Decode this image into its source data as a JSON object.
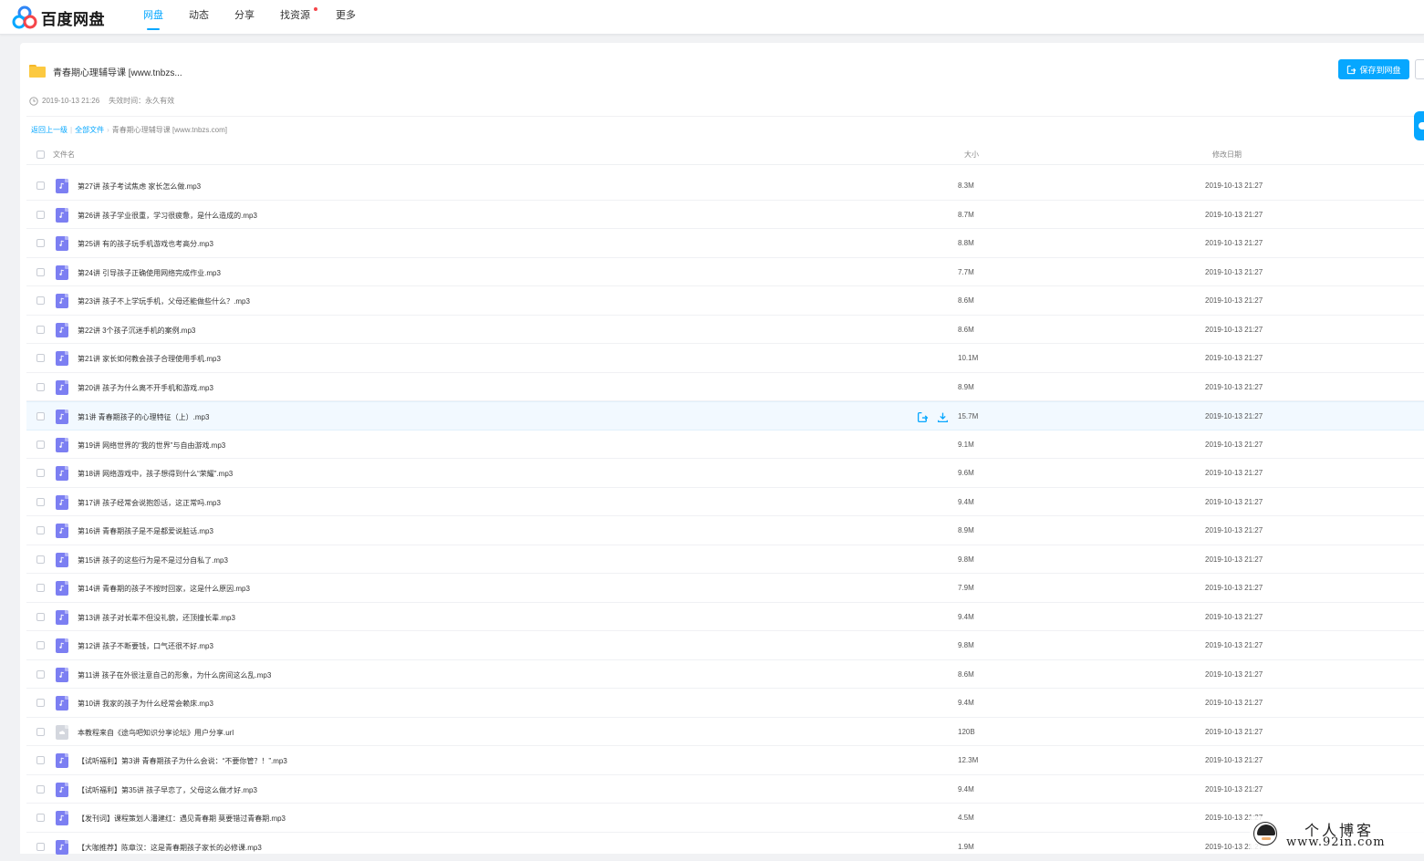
{
  "app": {
    "name": "百度网盘"
  },
  "nav": [
    {
      "label": "网盘",
      "active": true
    },
    {
      "label": "动态",
      "active": false
    },
    {
      "label": "分享",
      "active": false
    },
    {
      "label": "找资源",
      "active": false,
      "dot": true
    },
    {
      "label": "更多",
      "active": false
    }
  ],
  "share": {
    "title": "青春期心理辅导课 [www.tnbzs...",
    "created": "2019-10-13 21:26",
    "expire": "失效时间：永久有效",
    "save_label": "保存到网盘"
  },
  "breadcrumb": {
    "back": "返回上一级",
    "all": "全部文件",
    "sep": "|",
    "arrow": "›",
    "current": "青春期心理辅导课 [www.tnbzs.com]"
  },
  "table": {
    "col_name": "文件名",
    "col_size": "大小",
    "col_date": "修改日期",
    "rows": [
      {
        "name": "第27讲 孩子考试焦虑 家长怎么做.mp3",
        "size": "8.3M",
        "date": "2019-10-13 21:27",
        "type": "audio"
      },
      {
        "name": "第26讲 孩子学业很重，学习很疲惫，是什么造成的.mp3",
        "size": "8.7M",
        "date": "2019-10-13 21:27",
        "type": "audio"
      },
      {
        "name": "第25讲 有的孩子玩手机游戏也考高分.mp3",
        "size": "8.8M",
        "date": "2019-10-13 21:27",
        "type": "audio"
      },
      {
        "name": "第24讲 引导孩子正确使用网络完成作业.mp3",
        "size": "7.7M",
        "date": "2019-10-13 21:27",
        "type": "audio"
      },
      {
        "name": "第23讲 孩子不上学玩手机，父母还能做些什么？.mp3",
        "size": "8.6M",
        "date": "2019-10-13 21:27",
        "type": "audio"
      },
      {
        "name": "第22讲 3个孩子沉迷手机的案例.mp3",
        "size": "8.6M",
        "date": "2019-10-13 21:27",
        "type": "audio"
      },
      {
        "name": "第21讲 家长如何教会孩子合理使用手机.mp3",
        "size": "10.1M",
        "date": "2019-10-13 21:27",
        "type": "audio"
      },
      {
        "name": "第20讲 孩子为什么离不开手机和游戏.mp3",
        "size": "8.9M",
        "date": "2019-10-13 21:27",
        "type": "audio"
      },
      {
        "name": "第1讲 青春期孩子的心理特征（上）.mp3",
        "size": "15.7M",
        "date": "2019-10-13 21:27",
        "type": "audio",
        "hover": true
      },
      {
        "name": "第19讲 网络世界的“我的世界”与自由游戏.mp3",
        "size": "9.1M",
        "date": "2019-10-13 21:27",
        "type": "audio"
      },
      {
        "name": "第18讲 网络游戏中，孩子想得到什么“荣耀”.mp3",
        "size": "9.6M",
        "date": "2019-10-13 21:27",
        "type": "audio"
      },
      {
        "name": "第17讲 孩子经常会说抱怨话，这正常吗.mp3",
        "size": "9.4M",
        "date": "2019-10-13 21:27",
        "type": "audio"
      },
      {
        "name": "第16讲 青春期孩子是不是都爱说脏话.mp3",
        "size": "8.9M",
        "date": "2019-10-13 21:27",
        "type": "audio"
      },
      {
        "name": "第15讲 孩子的这些行为是不是过分自私了.mp3",
        "size": "9.8M",
        "date": "2019-10-13 21:27",
        "type": "audio"
      },
      {
        "name": "第14讲 青春期的孩子不按时回家，这是什么原因.mp3",
        "size": "7.9M",
        "date": "2019-10-13 21:27",
        "type": "audio"
      },
      {
        "name": "第13讲 孩子对长辈不但没礼貌，还顶撞长辈.mp3",
        "size": "9.4M",
        "date": "2019-10-13 21:27",
        "type": "audio"
      },
      {
        "name": "第12讲 孩子不断要钱，口气还很不好.mp3",
        "size": "9.8M",
        "date": "2019-10-13 21:27",
        "type": "audio"
      },
      {
        "name": "第11讲 孩子在外很注意自己的形象，为什么房间这么乱.mp3",
        "size": "8.6M",
        "date": "2019-10-13 21:27",
        "type": "audio"
      },
      {
        "name": "第10讲 我家的孩子为什么经常会赖床.mp3",
        "size": "9.4M",
        "date": "2019-10-13 21:27",
        "type": "audio"
      },
      {
        "name": "本教程来自《途鸟吧知识分享论坛》用户分享.url",
        "size": "120B",
        "date": "2019-10-13 21:27",
        "type": "link"
      },
      {
        "name": "【试听福利】第3讲 青春期孩子为什么会说：“不要你管？！”.mp3",
        "size": "12.3M",
        "date": "2019-10-13 21:27",
        "type": "audio"
      },
      {
        "name": "【试听福利】第35讲 孩子早恋了，父母这么做才好.mp3",
        "size": "9.4M",
        "date": "2019-10-13 21:27",
        "type": "audio"
      },
      {
        "name": "【发刊词】课程策划人潘建红：遇见青春期 莫要错过青春期.mp3",
        "size": "4.5M",
        "date": "2019-10-13 21:27",
        "type": "audio"
      },
      {
        "name": "【大咖推荐】陈章汉：这是青春期孩子家长的必修课.mp3",
        "size": "1.9M",
        "date": "2019-10-13 21:27",
        "type": "audio"
      }
    ]
  },
  "watermark": {
    "line1": "个人博客",
    "line2": "www.92in.com"
  },
  "colors": {
    "accent": "#06a7ff",
    "audio_icon": "#7c7ff2",
    "hover_row": "#f2f9ff"
  }
}
